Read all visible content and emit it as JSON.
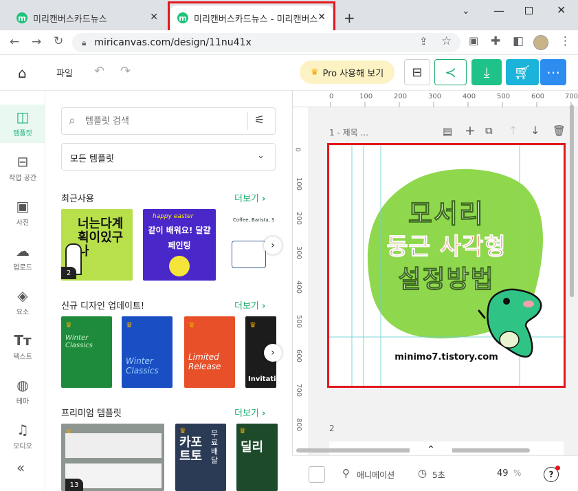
{
  "browser": {
    "tabs": [
      {
        "title": "미리캔버스카드뉴스",
        "favicon": "m"
      },
      {
        "title": "미리캔버스카드뉴스 - 미리캔버스",
        "favicon": "m"
      }
    ],
    "new_tab": "+",
    "url": "miricanvas.com/design/11nu41x"
  },
  "toolbar": {
    "file_label": "파일",
    "pro_label": "Pro 사용해 보기"
  },
  "rail": [
    {
      "label": "템플릿",
      "icon": "layout-icon",
      "glyph": "◫",
      "active": true
    },
    {
      "label": "작업 공간",
      "icon": "workspace-icon",
      "glyph": "⊟"
    },
    {
      "label": "사진",
      "icon": "photo-icon",
      "glyph": "▣"
    },
    {
      "label": "업로드",
      "icon": "upload-icon",
      "glyph": "☁"
    },
    {
      "label": "요소",
      "icon": "elements-icon",
      "glyph": "◈"
    },
    {
      "label": "텍스트",
      "icon": "text-icon",
      "glyph": "Tт"
    },
    {
      "label": "테마",
      "icon": "palette-icon",
      "glyph": "◍"
    },
    {
      "label": "오디오",
      "icon": "music-icon",
      "glyph": "♫"
    }
  ],
  "rail_collapse": "«",
  "panel": {
    "search_placeholder": "템플릿 검색",
    "dropdown_value": "모든 템플릿",
    "sections": [
      {
        "title": "최근사용",
        "more": "더보기"
      },
      {
        "title": "신규 디자인 업데이트!",
        "more": "더보기"
      },
      {
        "title": "프리미엄 템플릿",
        "more": "더보기"
      }
    ],
    "thumbs": {
      "recent1_text": "너는다계획이있구나",
      "recent1_badge": "2",
      "recent2_top": "happy easter",
      "recent2_main": "같이 배워요! 달걀페인팅",
      "recent3_text": "Coffee, Barista, S",
      "new1_text": "Winter Classics",
      "new2_text": "Winter Classics",
      "new3_text": "Limited Release",
      "new4_text": "Invitati",
      "prem1_badge": "13",
      "prem2_text": "카포 트토",
      "prem2_side": "무료 배달",
      "prem3_text": "딜리"
    }
  },
  "ruler": {
    "h_ticks": [
      "0",
      "100",
      "200",
      "300",
      "400",
      "500",
      "600",
      "700"
    ],
    "v_ticks": [
      "0",
      "100",
      "200",
      "300",
      "400",
      "500",
      "600",
      "700",
      "800"
    ]
  },
  "page1": {
    "label": "1 - 제목 ...",
    "line1": "모서리",
    "line2": "둥근 사각형",
    "line3": "설정방법",
    "url": "minimo7.tistory.com"
  },
  "page2_label": "2",
  "bottom": {
    "animation_label": "애니메이션",
    "duration_label": "5초",
    "zoom_value": "49",
    "zoom_unit": "%",
    "help": "?"
  },
  "colors": {
    "accent": "#1fae72",
    "blob": "#8fd84d",
    "headline_red": "#d9442a",
    "highlight": "#e3171c"
  }
}
